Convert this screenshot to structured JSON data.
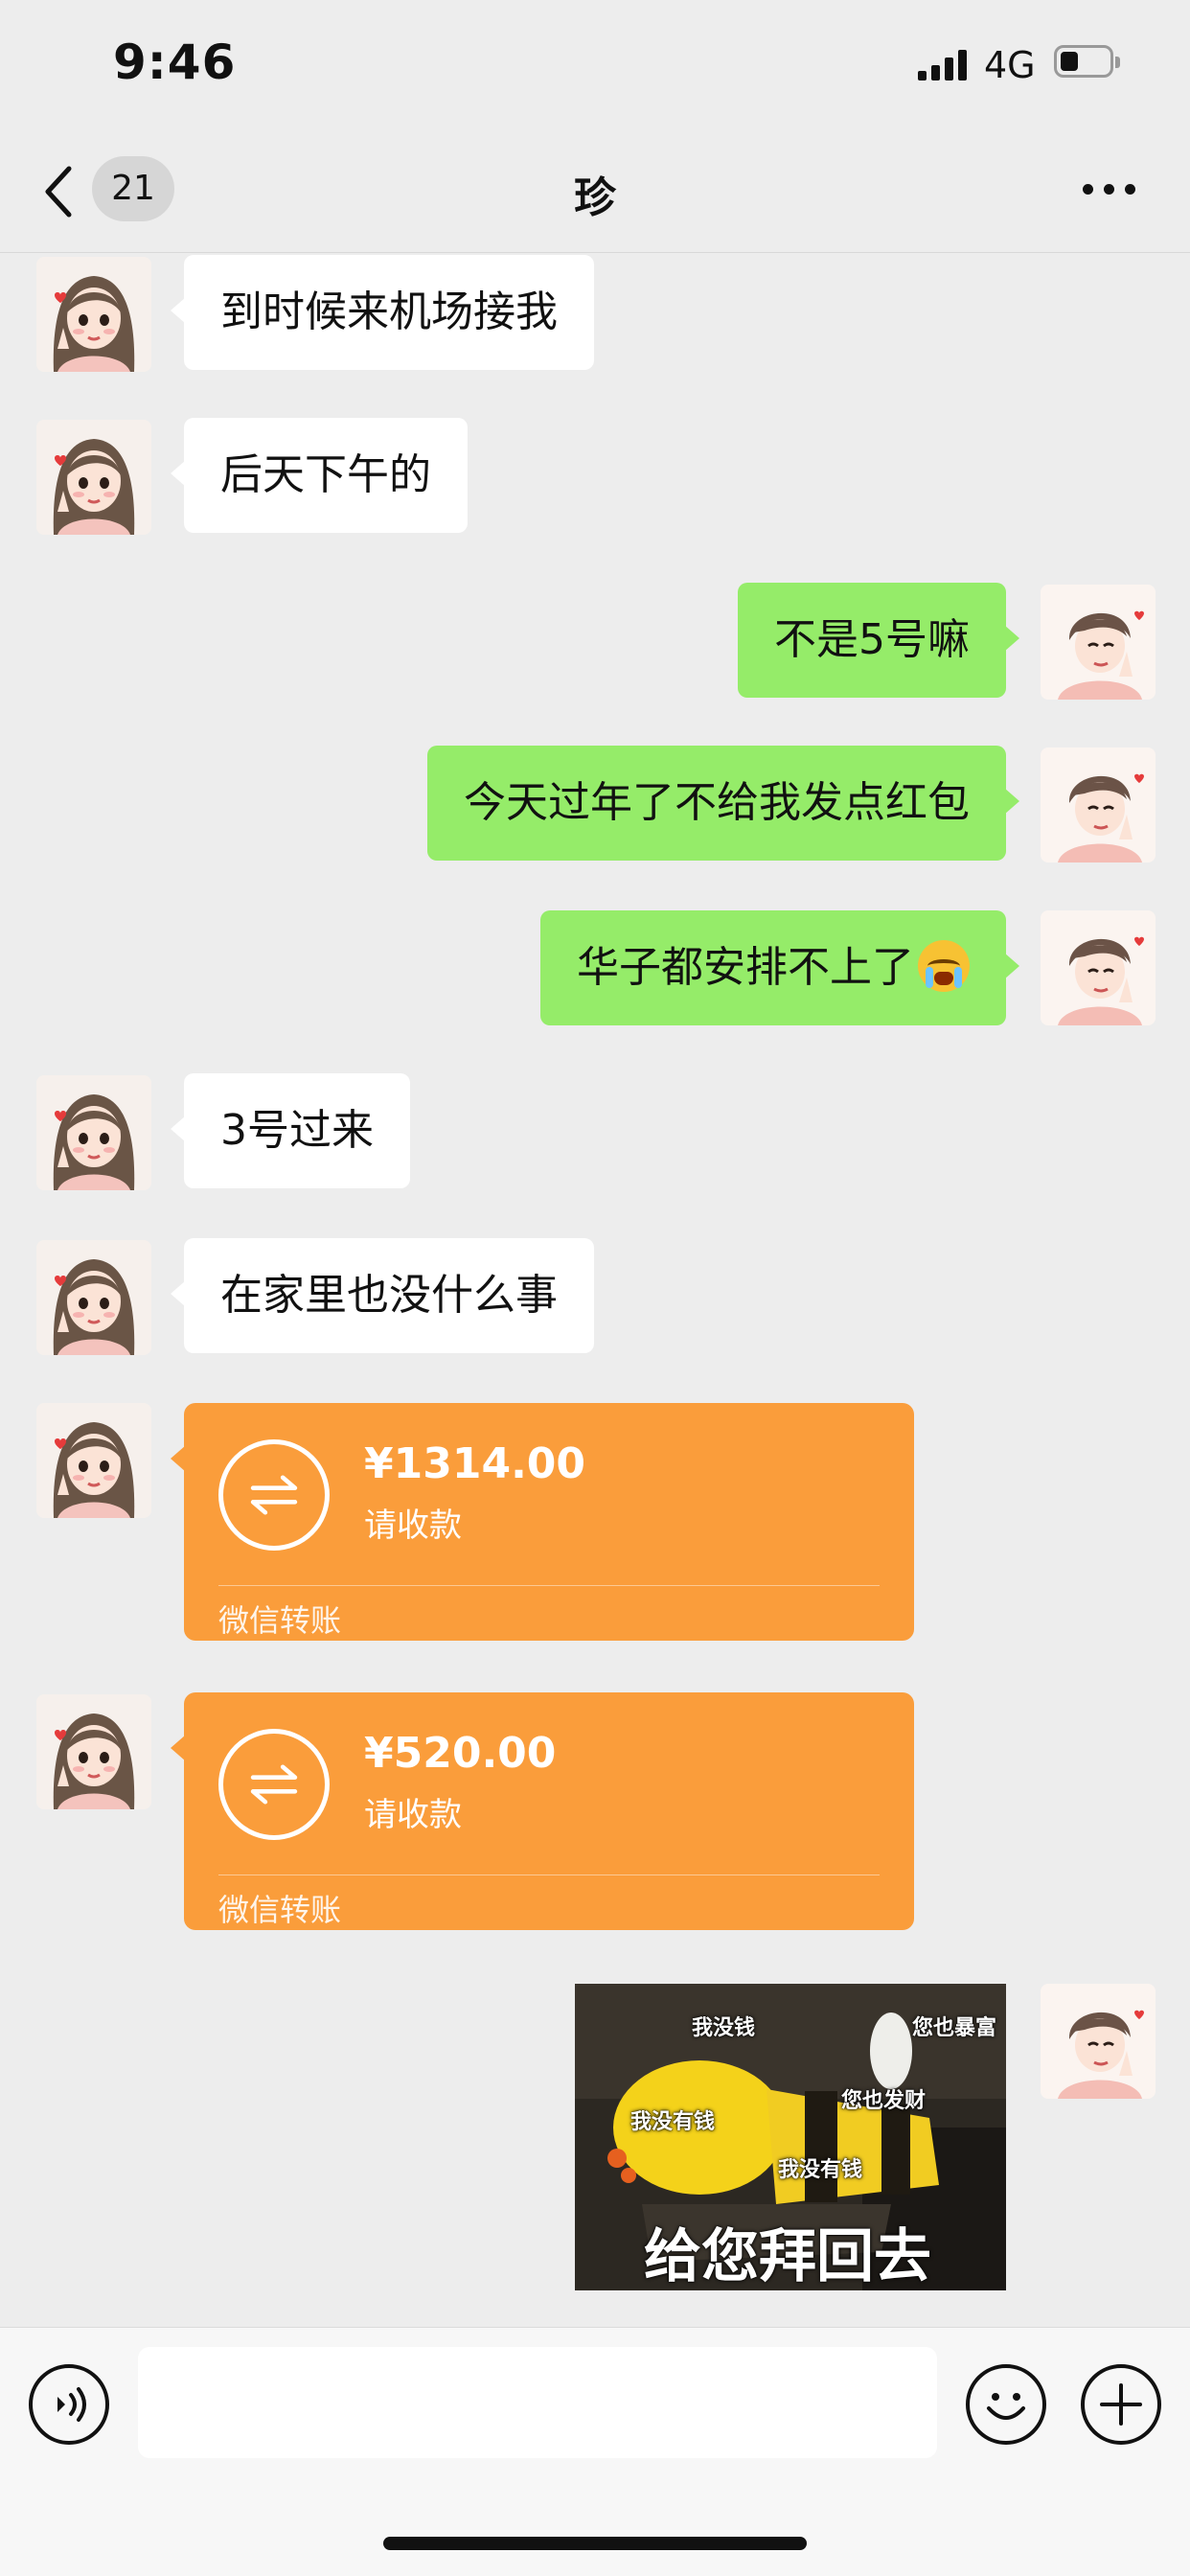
{
  "status_bar": {
    "time": "9:46",
    "network": "4G",
    "battery_percent": 25
  },
  "nav": {
    "unread_count": "21",
    "title": "珍"
  },
  "messages": {
    "m1": "到时候来机场接我",
    "m2": "后天下午的",
    "m3": "不是5号嘛",
    "m4": "今天过年了不给我发点红包",
    "m5": "华子都安排不上了",
    "m5_emoji": "crying-face",
    "m6": "3号过来",
    "m7": "在家里也没什么事"
  },
  "transfers": [
    {
      "amount": "¥1314.00",
      "status": "请收款",
      "label": "微信转账"
    },
    {
      "amount": "¥520.00",
      "status": "请收款",
      "label": "微信转账"
    }
  ],
  "sticker": {
    "captions": [
      "我没钱",
      "您也暴富",
      "我没有钱",
      "您也发财",
      "我没有钱"
    ],
    "main_caption": "给您拜回去"
  },
  "input_bar": {
    "value": ""
  },
  "colors": {
    "outgoing_bubble": "#95ec69",
    "incoming_bubble": "#ffffff",
    "transfer": "#fa9d3b",
    "background": "#ededed"
  }
}
